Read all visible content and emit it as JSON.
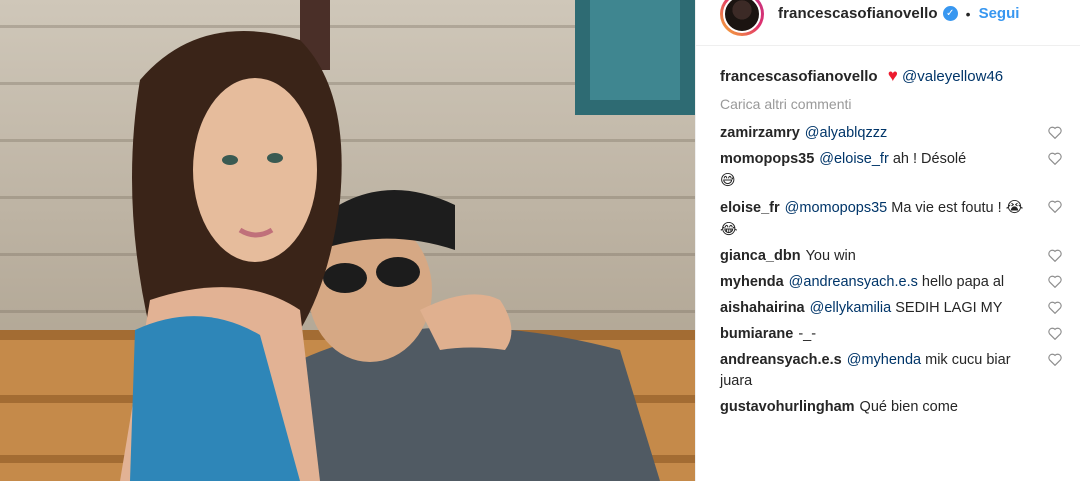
{
  "post": {
    "author": "francescasofianovello",
    "verified_glyph": "✓",
    "separator": "•",
    "follow_label": "Segui",
    "caption_heart": "♥",
    "caption_mention": "@valeyellow46",
    "load_more_label": "Carica altri commenti"
  },
  "comments": [
    {
      "user": "zamirzamry",
      "mention": "@alyablqzzz",
      "text": "",
      "emoji": ""
    },
    {
      "user": "momopops35",
      "mention": "@eloise_fr",
      "text": "ah ! Désolé",
      "emoji": "😅"
    },
    {
      "user": "eloise_fr",
      "mention": "@momopops35",
      "text": "Ma vie est foutu !",
      "emoji": "😭😂"
    },
    {
      "user": "gianca_dbn",
      "mention": "",
      "text": "You win",
      "emoji": ""
    },
    {
      "user": "myhenda",
      "mention": "@andreansyach.e.s",
      "text": "hello papa al",
      "emoji": ""
    },
    {
      "user": "aishahairina",
      "mention": "@ellykamilia",
      "text": "SEDIH LAGI MY",
      "emoji": ""
    },
    {
      "user": "bumiarane",
      "mention": "",
      "text": "-_-",
      "emoji": ""
    },
    {
      "user": "andreansyach.e.s",
      "mention": "@myhenda",
      "text": "mik cucu biar juara",
      "emoji": ""
    },
    {
      "user": "gustavohurlingham",
      "mention": "",
      "text": "Qué bien come",
      "emoji": ""
    }
  ],
  "icons": {
    "like": "heart-outline-icon",
    "verified": "verified-badge-icon"
  },
  "colors": {
    "link": "#3897f0",
    "mention": "#003569",
    "heart": "#ed1b2f",
    "muted": "#999999"
  }
}
